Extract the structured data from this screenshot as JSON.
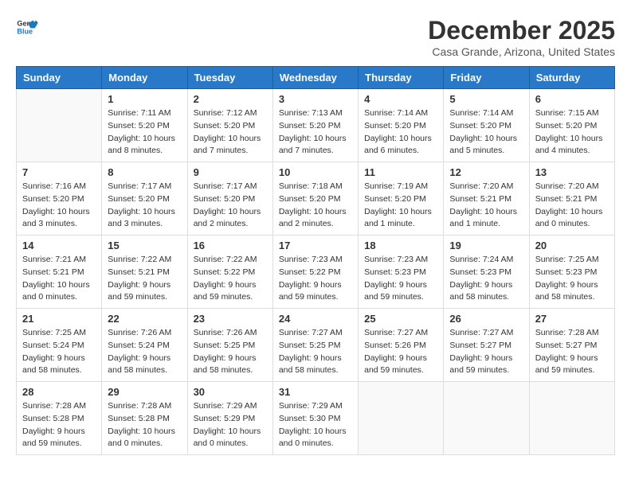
{
  "header": {
    "logo_line1": "General",
    "logo_line2": "Blue",
    "month_year": "December 2025",
    "location": "Casa Grande, Arizona, United States"
  },
  "days_of_week": [
    "Sunday",
    "Monday",
    "Tuesday",
    "Wednesday",
    "Thursday",
    "Friday",
    "Saturday"
  ],
  "weeks": [
    [
      {
        "day": "",
        "content": ""
      },
      {
        "day": "1",
        "content": "Sunrise: 7:11 AM\nSunset: 5:20 PM\nDaylight: 10 hours\nand 8 minutes."
      },
      {
        "day": "2",
        "content": "Sunrise: 7:12 AM\nSunset: 5:20 PM\nDaylight: 10 hours\nand 7 minutes."
      },
      {
        "day": "3",
        "content": "Sunrise: 7:13 AM\nSunset: 5:20 PM\nDaylight: 10 hours\nand 7 minutes."
      },
      {
        "day": "4",
        "content": "Sunrise: 7:14 AM\nSunset: 5:20 PM\nDaylight: 10 hours\nand 6 minutes."
      },
      {
        "day": "5",
        "content": "Sunrise: 7:14 AM\nSunset: 5:20 PM\nDaylight: 10 hours\nand 5 minutes."
      },
      {
        "day": "6",
        "content": "Sunrise: 7:15 AM\nSunset: 5:20 PM\nDaylight: 10 hours\nand 4 minutes."
      }
    ],
    [
      {
        "day": "7",
        "content": "Sunrise: 7:16 AM\nSunset: 5:20 PM\nDaylight: 10 hours\nand 3 minutes."
      },
      {
        "day": "8",
        "content": "Sunrise: 7:17 AM\nSunset: 5:20 PM\nDaylight: 10 hours\nand 3 minutes."
      },
      {
        "day": "9",
        "content": "Sunrise: 7:17 AM\nSunset: 5:20 PM\nDaylight: 10 hours\nand 2 minutes."
      },
      {
        "day": "10",
        "content": "Sunrise: 7:18 AM\nSunset: 5:20 PM\nDaylight: 10 hours\nand 2 minutes."
      },
      {
        "day": "11",
        "content": "Sunrise: 7:19 AM\nSunset: 5:20 PM\nDaylight: 10 hours\nand 1 minute."
      },
      {
        "day": "12",
        "content": "Sunrise: 7:20 AM\nSunset: 5:21 PM\nDaylight: 10 hours\nand 1 minute."
      },
      {
        "day": "13",
        "content": "Sunrise: 7:20 AM\nSunset: 5:21 PM\nDaylight: 10 hours\nand 0 minutes."
      }
    ],
    [
      {
        "day": "14",
        "content": "Sunrise: 7:21 AM\nSunset: 5:21 PM\nDaylight: 10 hours\nand 0 minutes."
      },
      {
        "day": "15",
        "content": "Sunrise: 7:22 AM\nSunset: 5:21 PM\nDaylight: 9 hours\nand 59 minutes."
      },
      {
        "day": "16",
        "content": "Sunrise: 7:22 AM\nSunset: 5:22 PM\nDaylight: 9 hours\nand 59 minutes."
      },
      {
        "day": "17",
        "content": "Sunrise: 7:23 AM\nSunset: 5:22 PM\nDaylight: 9 hours\nand 59 minutes."
      },
      {
        "day": "18",
        "content": "Sunrise: 7:23 AM\nSunset: 5:23 PM\nDaylight: 9 hours\nand 59 minutes."
      },
      {
        "day": "19",
        "content": "Sunrise: 7:24 AM\nSunset: 5:23 PM\nDaylight: 9 hours\nand 58 minutes."
      },
      {
        "day": "20",
        "content": "Sunrise: 7:25 AM\nSunset: 5:23 PM\nDaylight: 9 hours\nand 58 minutes."
      }
    ],
    [
      {
        "day": "21",
        "content": "Sunrise: 7:25 AM\nSunset: 5:24 PM\nDaylight: 9 hours\nand 58 minutes."
      },
      {
        "day": "22",
        "content": "Sunrise: 7:26 AM\nSunset: 5:24 PM\nDaylight: 9 hours\nand 58 minutes."
      },
      {
        "day": "23",
        "content": "Sunrise: 7:26 AM\nSunset: 5:25 PM\nDaylight: 9 hours\nand 58 minutes."
      },
      {
        "day": "24",
        "content": "Sunrise: 7:27 AM\nSunset: 5:25 PM\nDaylight: 9 hours\nand 58 minutes."
      },
      {
        "day": "25",
        "content": "Sunrise: 7:27 AM\nSunset: 5:26 PM\nDaylight: 9 hours\nand 59 minutes."
      },
      {
        "day": "26",
        "content": "Sunrise: 7:27 AM\nSunset: 5:27 PM\nDaylight: 9 hours\nand 59 minutes."
      },
      {
        "day": "27",
        "content": "Sunrise: 7:28 AM\nSunset: 5:27 PM\nDaylight: 9 hours\nand 59 minutes."
      }
    ],
    [
      {
        "day": "28",
        "content": "Sunrise: 7:28 AM\nSunset: 5:28 PM\nDaylight: 9 hours\nand 59 minutes."
      },
      {
        "day": "29",
        "content": "Sunrise: 7:28 AM\nSunset: 5:28 PM\nDaylight: 10 hours\nand 0 minutes."
      },
      {
        "day": "30",
        "content": "Sunrise: 7:29 AM\nSunset: 5:29 PM\nDaylight: 10 hours\nand 0 minutes."
      },
      {
        "day": "31",
        "content": "Sunrise: 7:29 AM\nSunset: 5:30 PM\nDaylight: 10 hours\nand 0 minutes."
      },
      {
        "day": "",
        "content": ""
      },
      {
        "day": "",
        "content": ""
      },
      {
        "day": "",
        "content": ""
      }
    ]
  ]
}
